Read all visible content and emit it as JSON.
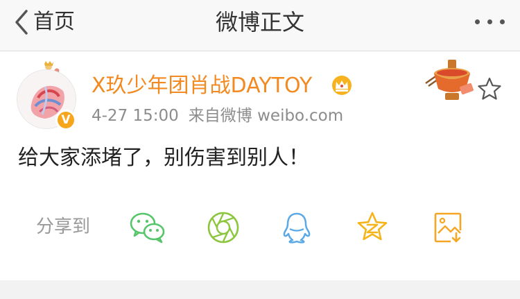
{
  "navbar": {
    "back_label": "首页",
    "title": "微博正文",
    "more_icon": "ellipsis-icon"
  },
  "post": {
    "username": "X玖少年团肖战DAYTOY",
    "verified_badge": "V",
    "time": "4-27 15:00",
    "source": "来自微博 weibo.com",
    "content": "给大家添堵了，别伤害到别人！"
  },
  "share": {
    "label": "分享到",
    "targets": [
      "wechat-icon",
      "moments-icon",
      "qq-icon",
      "qzone-icon",
      "save-image-icon"
    ]
  },
  "colors": {
    "username": "#f28a21",
    "meta": "#8c8c8c",
    "wechat": "#55c56a",
    "moments": "#8cc63f",
    "qq": "#5aa9e6",
    "qzone": "#f6b41b",
    "save_image": "#f6a623"
  }
}
